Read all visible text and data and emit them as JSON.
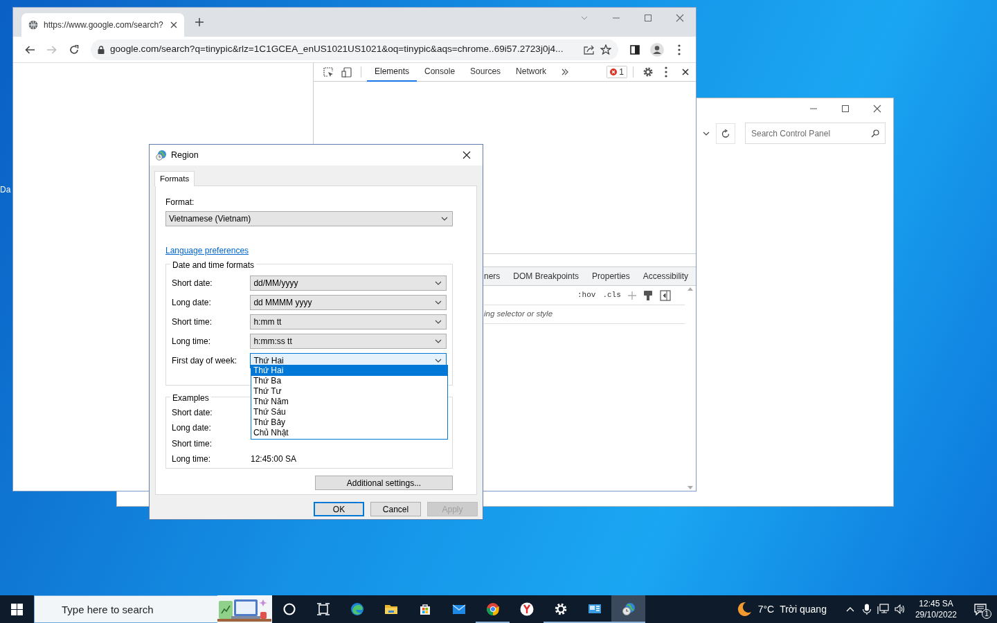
{
  "desktop": {
    "icon_labels": [
      "Da"
    ]
  },
  "browser": {
    "tab_title": "https://www.google.com/search?",
    "address": "google.com/search?q=tinypic&rlz=1C1GCEA_enUS1021US1021&oq=tinypic&aqs=chrome..69i57.2723j0j4...",
    "devtools": {
      "tabs": [
        {
          "label": "Elements",
          "selected": true
        },
        {
          "label": "Console",
          "selected": false
        },
        {
          "label": "Sources",
          "selected": false
        },
        {
          "label": "Network",
          "selected": false
        }
      ],
      "error_count": "1",
      "panel_tabs": [
        "ners",
        "DOM Breakpoints",
        "Properties",
        "Accessibility"
      ],
      "filter_buttons": [
        ":hov",
        ".cls"
      ],
      "filter_text": "ing selector or style"
    }
  },
  "control_panel": {
    "search_placeholder": "Search Control Panel"
  },
  "region_dialog": {
    "title": "Region",
    "tabs": [
      {
        "label": "Formats",
        "selected": true
      }
    ],
    "format": {
      "label": "Format:",
      "value": "Vietnamese (Vietnam)"
    },
    "language_link": "Language preferences",
    "date_time_group": {
      "title": "Date and time formats",
      "fields": [
        {
          "label": "Short date:",
          "value": "dd/MM/yyyy",
          "focused": false
        },
        {
          "label": "Long date:",
          "value": "dd MMMM yyyy",
          "focused": false
        },
        {
          "label": "Short time:",
          "value": "h:mm tt",
          "focused": false
        },
        {
          "label": "Long time:",
          "value": "h:mm:ss tt",
          "focused": false
        },
        {
          "label": "First day of week:",
          "value": "Thứ Hai",
          "focused": true
        }
      ]
    },
    "dropdown_options": [
      {
        "label": "Thứ Hai",
        "selected": true
      },
      {
        "label": "Thứ Ba",
        "selected": false
      },
      {
        "label": "Thứ Tư",
        "selected": false
      },
      {
        "label": "Thứ Năm",
        "selected": false
      },
      {
        "label": "Thứ Sáu",
        "selected": false
      },
      {
        "label": "Thứ Bảy",
        "selected": false
      },
      {
        "label": "Chủ Nhật",
        "selected": false
      }
    ],
    "examples": {
      "title": "Examples",
      "rows": [
        {
          "label": "Short date:"
        },
        {
          "label": "Long date:"
        },
        {
          "label": "Short time:"
        },
        {
          "label": "Long time:",
          "value": "12:45:00 SA"
        }
      ]
    },
    "additional_settings": "Additional settings...",
    "buttons": [
      {
        "label": "OK",
        "default": true,
        "disabled": false
      },
      {
        "label": "Cancel",
        "default": false,
        "disabled": false
      },
      {
        "label": "Apply",
        "default": false,
        "disabled": true
      }
    ]
  },
  "taskbar": {
    "search_placeholder": "Type here to search",
    "apps": [
      {
        "kind": "cortana",
        "running": false,
        "active": false
      },
      {
        "kind": "taskview",
        "running": false,
        "active": false
      },
      {
        "kind": "edge",
        "running": false,
        "active": false
      },
      {
        "kind": "explorer",
        "running": false,
        "active": false
      },
      {
        "kind": "store",
        "running": false,
        "active": false
      },
      {
        "kind": "mail",
        "running": false,
        "active": false
      },
      {
        "kind": "chrome",
        "running": true,
        "active": false
      },
      {
        "kind": "yandex",
        "running": false,
        "active": false
      },
      {
        "kind": "settings",
        "running": true,
        "active": false
      },
      {
        "kind": "controlpanel",
        "running": true,
        "active": false
      },
      {
        "kind": "region",
        "running": true,
        "active": true
      }
    ],
    "weather": {
      "temperature": "7°C",
      "condition": "Trời quang"
    },
    "clock": {
      "time": "12:45 SA",
      "date": "29/10/2022"
    },
    "notification_count": "1"
  }
}
